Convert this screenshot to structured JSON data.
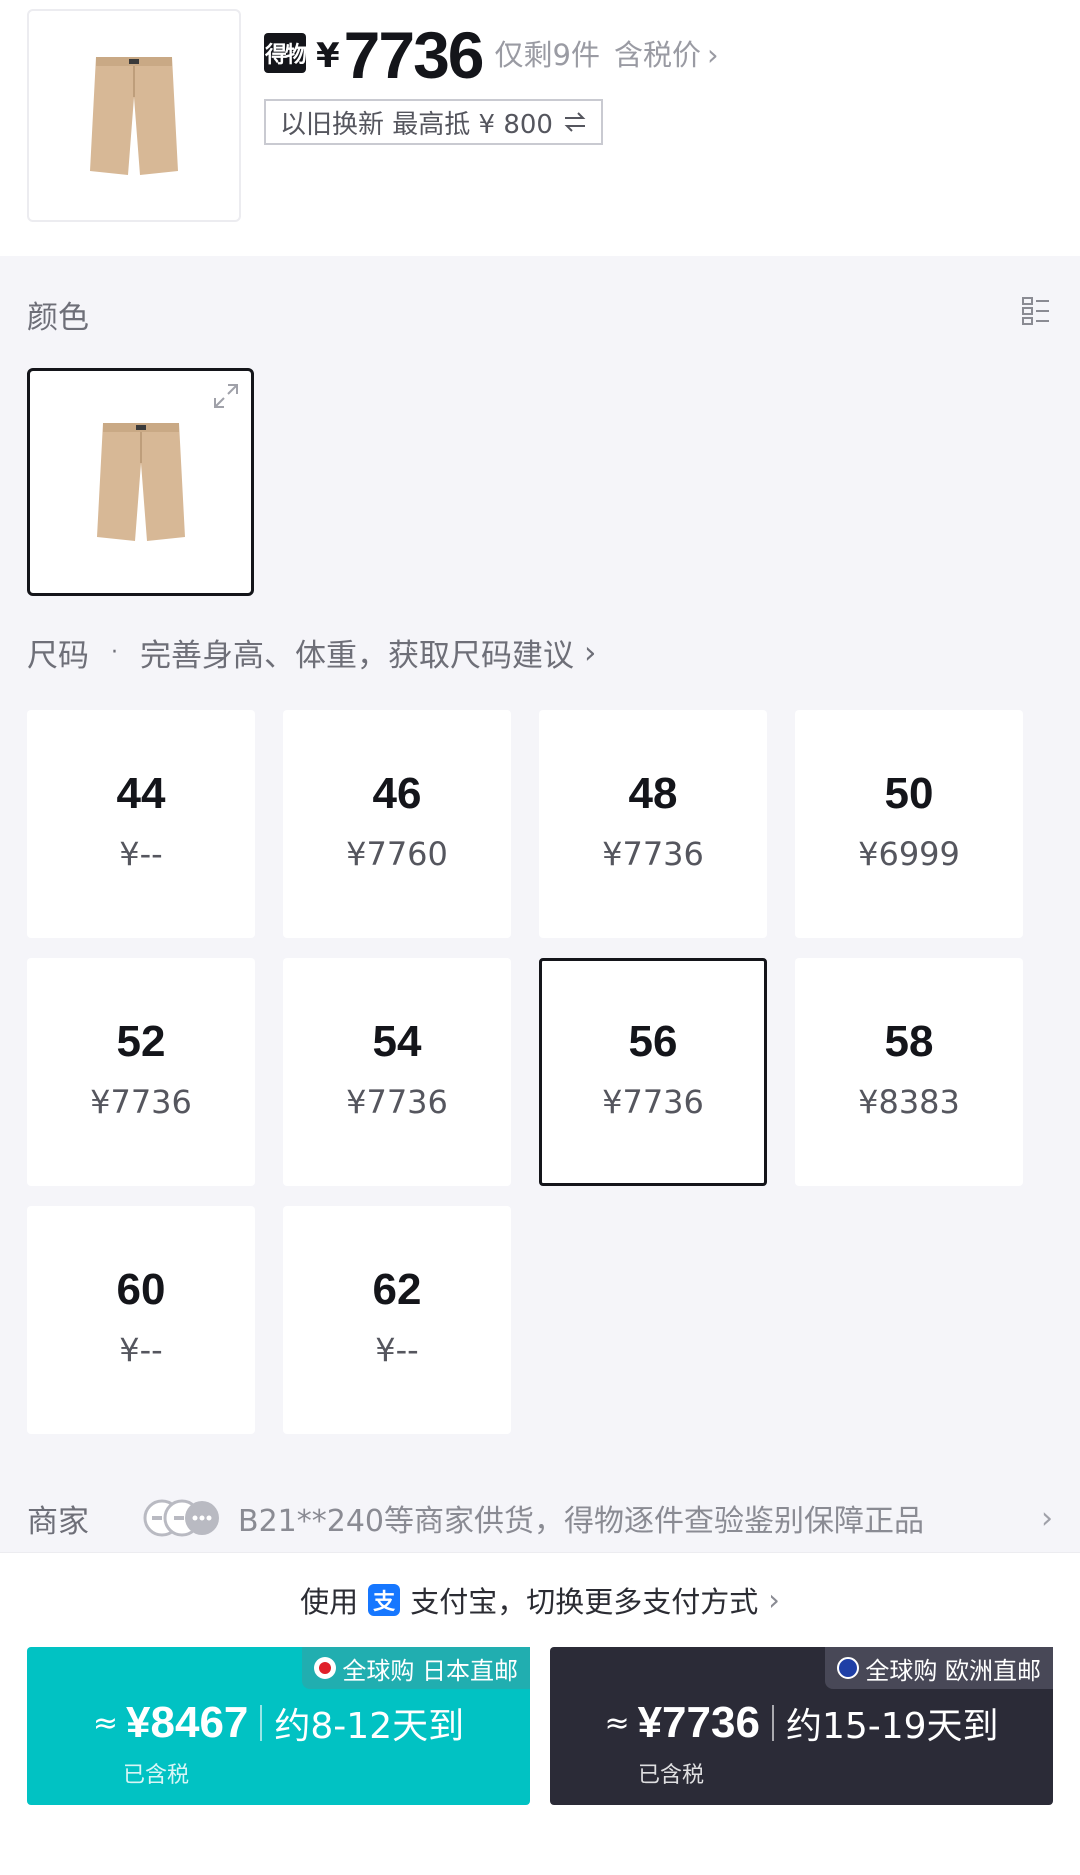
{
  "header": {
    "brand_logo_text": "得物",
    "currency": "¥",
    "price": "7736",
    "stock_text": "仅剩9件",
    "tax_text": "含税价",
    "chevron": "›",
    "trade_in_text": "以旧换新  最高抵 ¥ 800",
    "trade_in_icon": "swap-icon"
  },
  "color_section": {
    "label": "颜色",
    "view_toggle_icon": "list-view-icon",
    "expand_icon": "expand-icon"
  },
  "size_section": {
    "label": "尺码",
    "dot": "·",
    "hint": "完善身高、体重，获取尺码建议",
    "chevron": "›",
    "sizes": [
      {
        "size": "44",
        "price": "¥--"
      },
      {
        "size": "46",
        "price": "¥7760"
      },
      {
        "size": "48",
        "price": "¥7736"
      },
      {
        "size": "50",
        "price": "¥6999"
      },
      {
        "size": "52",
        "price": "¥7736"
      },
      {
        "size": "54",
        "price": "¥7736"
      },
      {
        "size": "56",
        "price": "¥7736"
      },
      {
        "size": "58",
        "price": "¥8383"
      },
      {
        "size": "60",
        "price": "¥--"
      },
      {
        "size": "62",
        "price": "¥--"
      }
    ],
    "selected_size": "56"
  },
  "merchant": {
    "label": "商家",
    "text": "B21**240等商家供货，得物逐件查验鉴别保障正品",
    "arrow": "›"
  },
  "payment": {
    "prefix": "使用",
    "icon_text": "支",
    "method": "支付宝，切换更多支付方式",
    "chevron": "›"
  },
  "buy_options": [
    {
      "tag": "全球购 日本直邮",
      "approx": "≈",
      "price": "¥8467",
      "eta": "约8-12天到",
      "tax_note": "已含税",
      "color": "#01c2c3"
    },
    {
      "tag": "全球购 欧洲直邮",
      "approx": "≈",
      "price": "¥7736",
      "eta": "约15-19天到",
      "tax_note": "已含税",
      "color": "#2b2b37"
    }
  ]
}
